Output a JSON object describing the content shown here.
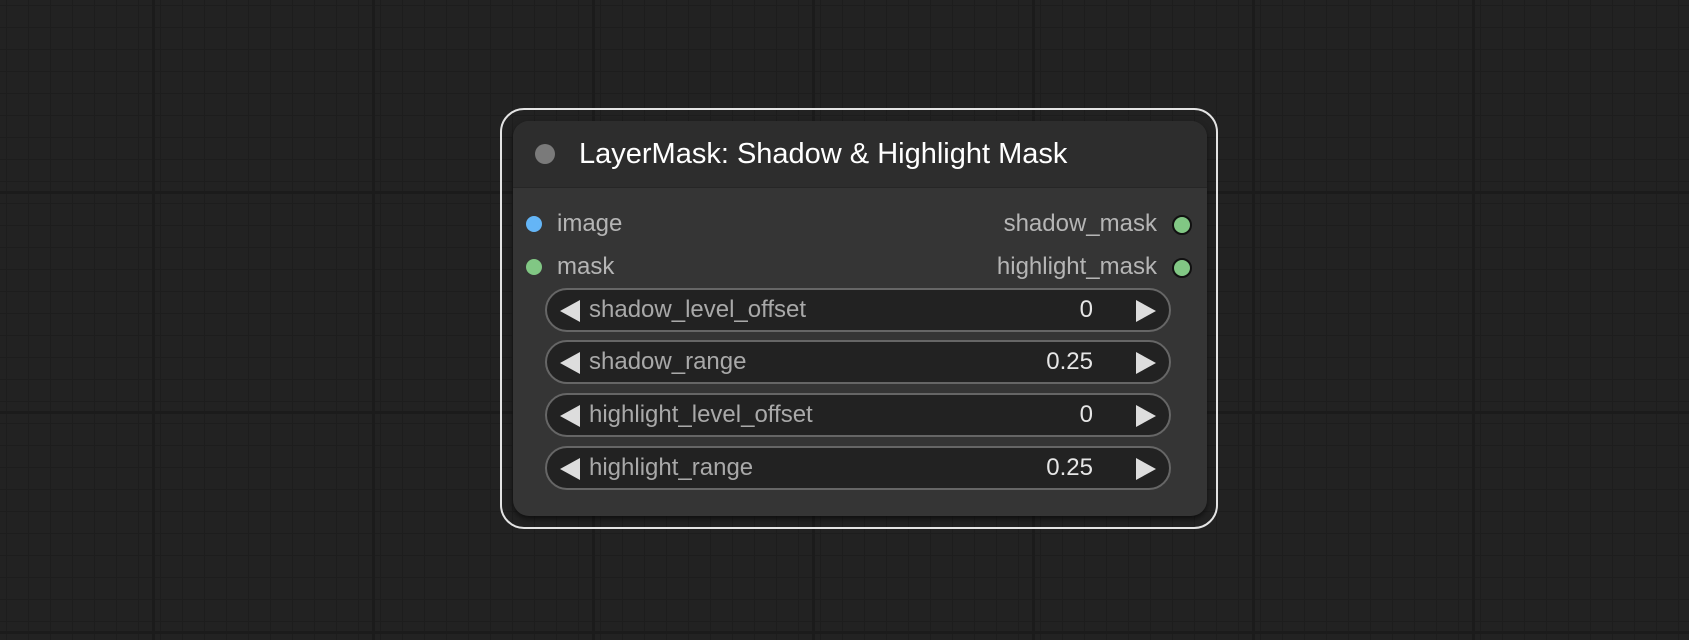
{
  "node": {
    "title": "LayerMask: Shadow & Highlight Mask",
    "inputs": [
      {
        "label": "image",
        "color": "#64b5f6"
      },
      {
        "label": "mask",
        "color": "#81c784"
      }
    ],
    "outputs": [
      {
        "label": "shadow_mask",
        "color": "#81c784"
      },
      {
        "label": "highlight_mask",
        "color": "#81c784"
      }
    ],
    "widgets": [
      {
        "label": "shadow_level_offset",
        "value": "0"
      },
      {
        "label": "shadow_range",
        "value": "0.25"
      },
      {
        "label": "highlight_level_offset",
        "value": "0"
      },
      {
        "label": "highlight_range",
        "value": "0.25"
      }
    ]
  },
  "icons": {
    "collapse": "circle-dot-icon",
    "decrement": "triangle-left-icon",
    "increment": "triangle-right-icon"
  },
  "colors": {
    "canvas_background": "#222222",
    "node_body": "#353535",
    "node_header": "#2d2d2d",
    "selection_outline": "#e4e4e4",
    "image_slot": "#64b5f6",
    "mask_slot": "#81c784"
  }
}
